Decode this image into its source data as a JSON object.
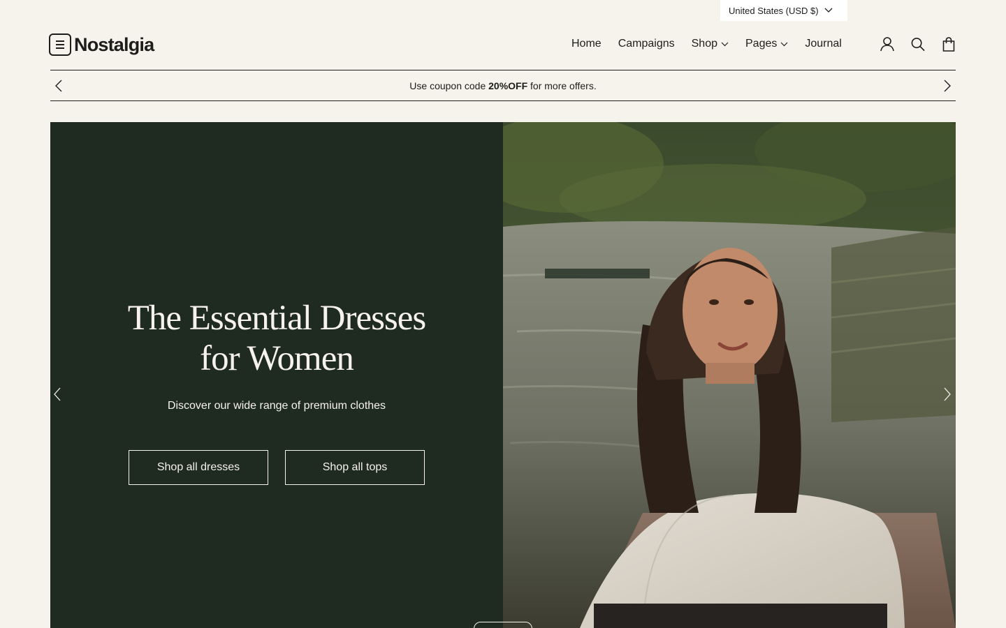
{
  "currency": {
    "label": "United States (USD $)",
    "icon": "chevron-down-icon"
  },
  "brand": {
    "name": "Nostalgia",
    "menu_icon": "hamburger-menu-icon"
  },
  "nav": {
    "items": [
      {
        "label": "Home",
        "has_dropdown": false
      },
      {
        "label": "Campaigns",
        "has_dropdown": false
      },
      {
        "label": "Shop",
        "has_dropdown": true
      },
      {
        "label": "Pages",
        "has_dropdown": true
      },
      {
        "label": "Journal",
        "has_dropdown": false
      }
    ]
  },
  "header_icons": [
    "account-icon",
    "search-icon",
    "cart-icon"
  ],
  "announcement": {
    "prefix": "Use coupon code ",
    "code": "20%OFF",
    "suffix": " for more offers."
  },
  "hero": {
    "title_line1": "The Essential Dresses",
    "title_line2": "for Women",
    "subtitle": "Discover our wide range of premium clothes",
    "buttons": [
      {
        "label": "Shop all dresses"
      },
      {
        "label": "Shop all tops"
      }
    ],
    "image_alt": "woman in oatmeal sweatshirt standing on a dock by a lake",
    "panel_color": "#1f2b21"
  },
  "colors": {
    "background": "#f6f2ec",
    "text": "#1d1d1b",
    "hero_panel": "#1f2b21"
  }
}
